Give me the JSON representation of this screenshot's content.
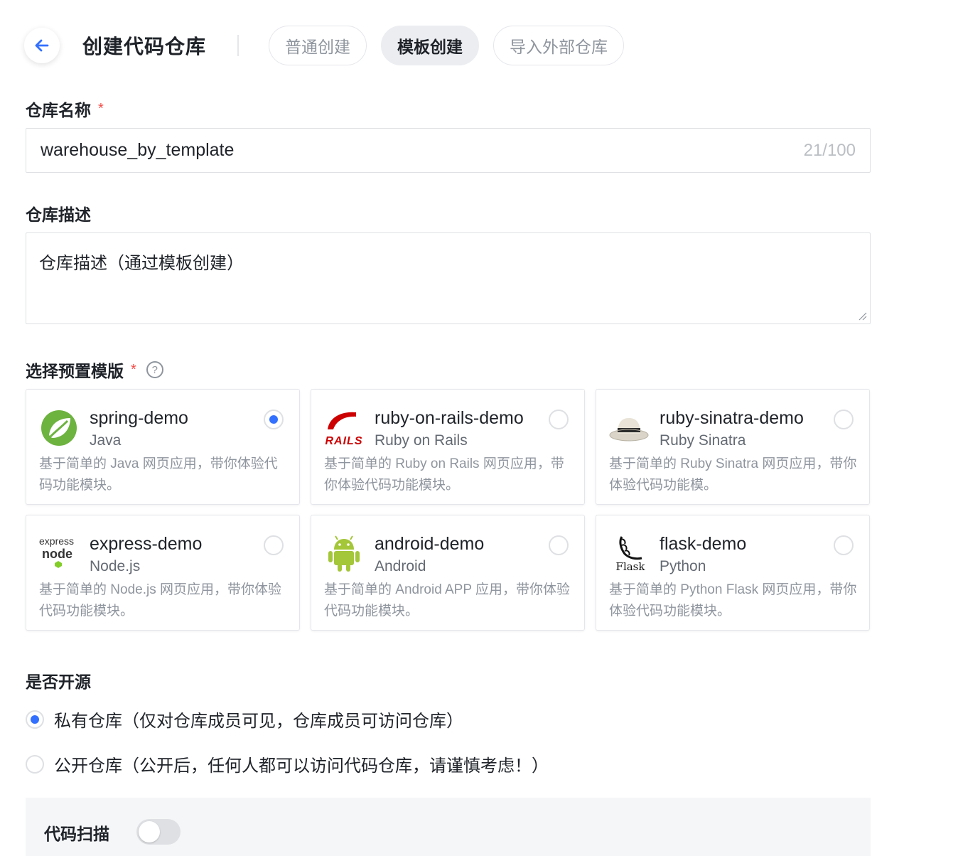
{
  "header": {
    "title": "创建代码仓库",
    "tabs": [
      {
        "label": "普通创建",
        "active": false
      },
      {
        "label": "模板创建",
        "active": true
      },
      {
        "label": "导入外部仓库",
        "active": false
      }
    ]
  },
  "repo_name": {
    "label": "仓库名称",
    "required_mark": "*",
    "value": "warehouse_by_template",
    "counter": "21/100"
  },
  "repo_desc": {
    "label": "仓库描述",
    "value": "仓库描述（通过模板创建）"
  },
  "template": {
    "label": "选择预置模版",
    "required_mark": "*",
    "help_icon": "question-circle-icon",
    "items": [
      {
        "name": "spring-demo",
        "lang": "Java",
        "desc": "基于简单的 Java 网页应用，带你体验代码功能模块。",
        "selected": true,
        "logo": "spring-logo"
      },
      {
        "name": "ruby-on-rails-demo",
        "lang": "Ruby on Rails",
        "desc": "基于简单的 Ruby on Rails 网页应用，带你体验代码功能模块。",
        "selected": false,
        "logo": "rails-logo",
        "logo_text": "RAILS"
      },
      {
        "name": "ruby-sinatra-demo",
        "lang": "Ruby Sinatra",
        "desc": "基于简单的 Ruby Sinatra 网页应用，带你体验代码功能模。",
        "selected": false,
        "logo": "sinatra-hat-logo"
      },
      {
        "name": "express-demo",
        "lang": "Node.js",
        "desc": "基于简单的 Node.js 网页应用，带你体验代码功能模块。",
        "selected": false,
        "logo": "express-node-logo",
        "logo_text_top": "express",
        "logo_text_bottom": "node"
      },
      {
        "name": "android-demo",
        "lang": "Android",
        "desc": "基于简单的 Android APP 应用，带你体验代码功能模块。",
        "selected": false,
        "logo": "android-logo"
      },
      {
        "name": "flask-demo",
        "lang": "Python",
        "desc": "基于简单的 Python Flask 网页应用，带你体验代码功能模块。",
        "selected": false,
        "logo": "flask-logo",
        "logo_text": "Flask"
      }
    ]
  },
  "visibility": {
    "label": "是否开源",
    "options": [
      {
        "text": "私有仓库（仅对仓库成员可见，仓库成员可访问仓库）",
        "checked": true
      },
      {
        "text": "公开仓库（公开后，任何人都可以访问代码仓库，请谨慎考虑！）",
        "checked": false
      }
    ]
  },
  "code_scan": {
    "label": "代码扫描",
    "enabled": false
  },
  "colors": {
    "accent": "#3370ff",
    "required": "#f54a45",
    "spring_green": "#6db33f",
    "rails_red": "#cc0000",
    "android_green": "#a4c639"
  }
}
